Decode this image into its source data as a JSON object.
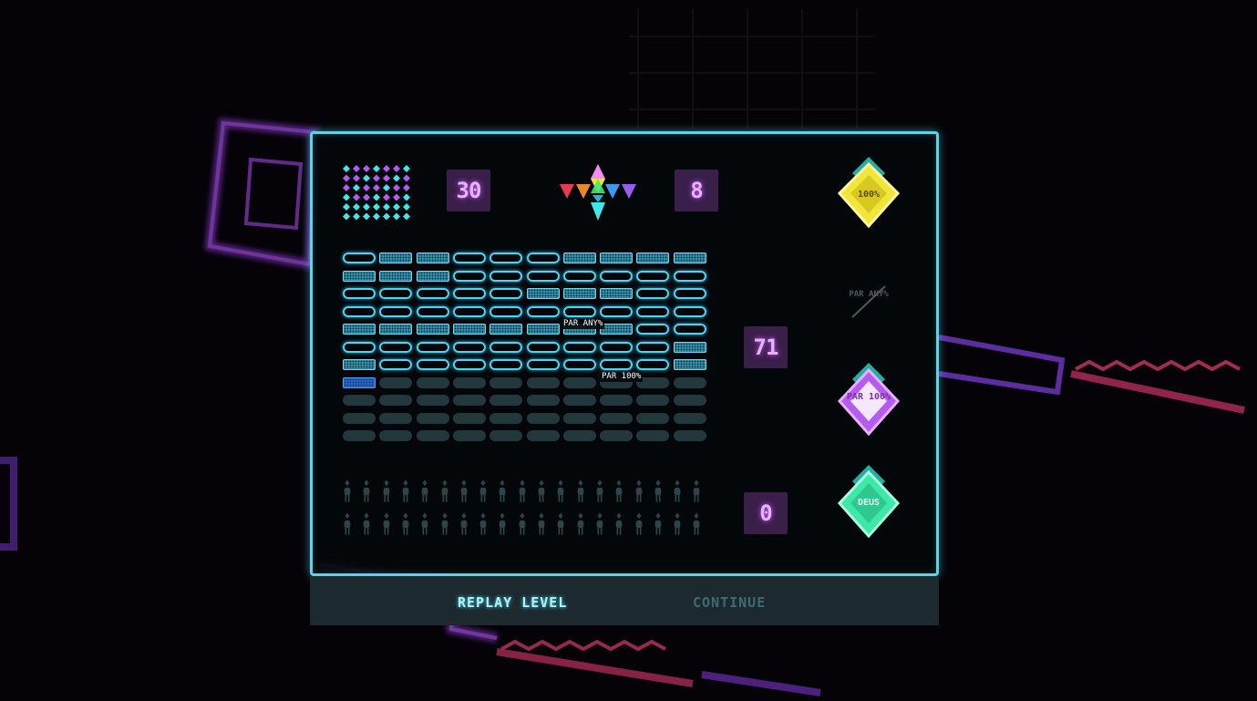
{
  "stats": {
    "collectibles_count": "30",
    "prisms_count": "8",
    "blocks_count": "71",
    "deaths_count": "0"
  },
  "grid": {
    "rows": [
      [
        "outline",
        "dots",
        "dots",
        "outline",
        "outline",
        "outline",
        "dots",
        "dots",
        "dots",
        "dots"
      ],
      [
        "dots",
        "dots",
        "dots",
        "outline",
        "outline",
        "outline",
        "outline",
        "outline",
        "outline",
        "outline"
      ],
      [
        "outline",
        "outline",
        "outline",
        "outline",
        "outline",
        "dots",
        "dots",
        "dots",
        "outline",
        "outline"
      ],
      [
        "outline",
        "outline",
        "outline",
        "outline",
        "outline",
        "outline",
        "outline",
        "outline",
        "outline",
        "outline"
      ],
      [
        "dots",
        "dots",
        "dots",
        "dots",
        "dots",
        "dots",
        "dots",
        "dots",
        "outline",
        "outline"
      ],
      [
        "outline",
        "outline",
        "outline",
        "outline",
        "outline",
        "outline",
        "outline",
        "outline",
        "outline",
        "dots"
      ],
      [
        "dots",
        "outline",
        "outline",
        "outline",
        "outline",
        "outline",
        "outline",
        "outline",
        "outline",
        "dots"
      ],
      [
        "blue",
        "empty",
        "empty",
        "empty",
        "empty",
        "empty",
        "empty",
        "empty",
        "empty",
        "empty"
      ],
      [
        "empty",
        "empty",
        "empty",
        "empty",
        "empty",
        "empty",
        "empty",
        "empty",
        "empty",
        "empty"
      ],
      [
        "empty",
        "empty",
        "empty",
        "empty",
        "empty",
        "empty",
        "empty",
        "empty",
        "empty",
        "empty"
      ],
      [
        "empty",
        "empty",
        "empty",
        "empty",
        "empty",
        "empty",
        "empty",
        "empty",
        "empty",
        "empty"
      ]
    ],
    "marker_par_any": "PAR ANY%",
    "marker_par_100": "PAR 100%"
  },
  "awards": {
    "award_100": "100%",
    "award_par_any": "PAR ANY%",
    "award_par_100": "PAR 100%",
    "award_deus": "DEUS"
  },
  "footer": {
    "replay_label": "REPLAY LEVEL",
    "continue_label": "CONTINUE"
  },
  "colors": {
    "panel_border": "#58d6e8",
    "counter_bg": "#3a1f4a",
    "counter_text": "#e8b0ff",
    "award_gold": "#f2e53a",
    "award_purple": "#b45cf0",
    "award_green": "#3ee8a8",
    "replay_color": "#a8f4ff",
    "continue_color": "#3f6a72"
  },
  "icons": {
    "collectibles": "diamond-grid-icon",
    "prisms": "rainbow-triangles-icon",
    "deaths": "person-figure-icon"
  }
}
